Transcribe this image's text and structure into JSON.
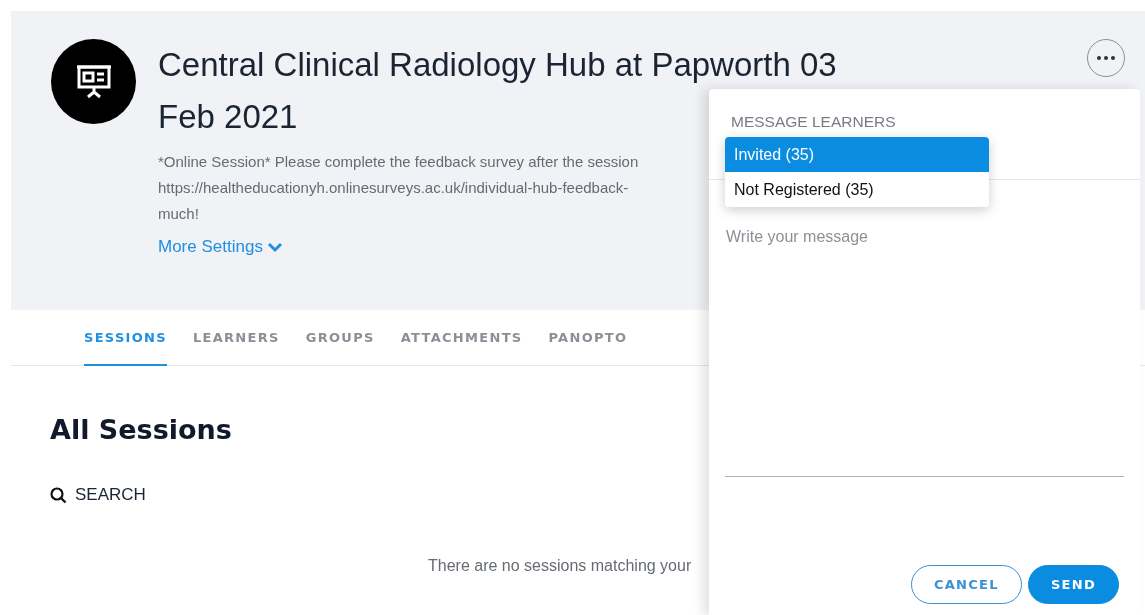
{
  "header": {
    "title_lines": [
      "Central Clinical Radiology Hub at Papworth 03",
      "Feb 2021"
    ],
    "description_lines": [
      "*Online Session* Please complete the feedback survey after the session",
      "https://healtheducationyh.onlinesurveys.ac.uk/individual-hub-feedback-",
      "much!"
    ],
    "more_settings": "More Settings"
  },
  "tabs": [
    {
      "label": "SESSIONS",
      "selected": true
    },
    {
      "label": "LEARNERS",
      "selected": false
    },
    {
      "label": "GROUPS",
      "selected": false
    },
    {
      "label": "ATTACHMENTS",
      "selected": false
    },
    {
      "label": "PANOPTO",
      "selected": false
    }
  ],
  "section_title": "All Sessions",
  "search_label": "SEARCH",
  "empty_message": "There are no sessions matching your",
  "panel": {
    "title": "MESSAGE LEARNERS",
    "options": [
      {
        "label": "Invited (35)",
        "selected": true
      },
      {
        "label": "Not Registered (35)",
        "selected": false
      }
    ],
    "message_placeholder": "Write your message",
    "buttons": [
      {
        "label": "CANCEL",
        "kind": "outline"
      },
      {
        "label": "SEND",
        "kind": "primary"
      }
    ]
  }
}
